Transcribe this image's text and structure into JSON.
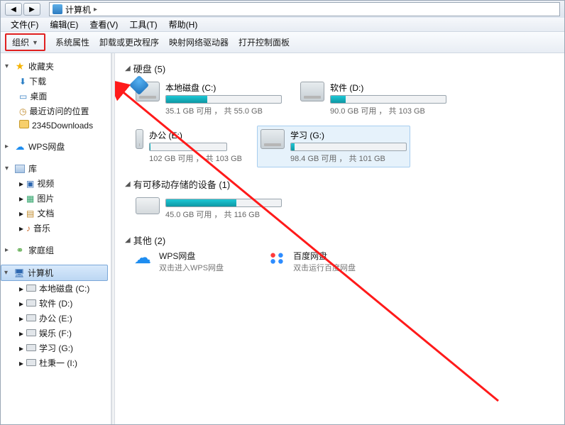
{
  "addressbar": {
    "location": "计算机",
    "chevron": "▸"
  },
  "nav": {
    "back": "◀",
    "forward": "▶"
  },
  "menus": {
    "file": "文件(F)",
    "edit": "编辑(E)",
    "view": "查看(V)",
    "tools": "工具(T)",
    "help": "帮助(H)"
  },
  "toolbar": {
    "organize": "组织",
    "organize_arrow": "▼",
    "system_properties": "系统属性",
    "uninstall": "卸载或更改程序",
    "map_network": "映射网络驱动器",
    "control_panel": "打开控制面板"
  },
  "sidebar": {
    "favorites": {
      "label": "收藏夹",
      "children": {
        "downloads": "下载",
        "desktop": "桌面",
        "recent": "最近访问的位置",
        "dl2345": "2345Downloads"
      }
    },
    "wps": {
      "label": "WPS网盘"
    },
    "libraries": {
      "label": "库",
      "children": {
        "videos": "视频",
        "pictures": "图片",
        "documents": "文档",
        "music": "音乐"
      }
    },
    "homegroup": {
      "label": "家庭组"
    },
    "computer": {
      "label": "计算机",
      "children": {
        "c": "本地磁盘 (C:)",
        "d": "软件 (D:)",
        "e": "办公 (E:)",
        "f": "娱乐 (F:)",
        "g": "学习 (G:)",
        "i": "杜秉一 (I:)"
      }
    }
  },
  "main": {
    "hard_drives": {
      "title": "硬盘 (5)",
      "c": {
        "label": "本地磁盘 (C:)",
        "sub": "35.1 GB 可用 ， 共 55.0 GB",
        "fill": 36
      },
      "d": {
        "label": "软件 (D:)",
        "sub": "90.0 GB 可用 ， 共 103 GB",
        "fill": 13
      },
      "e": {
        "label": "办公 (E:)",
        "sub": "102 GB 可用 ， 共 103 GB",
        "fill": 1
      },
      "g": {
        "label": "学习 (G:)",
        "sub": "98.4 GB 可用 ， 共 101 GB",
        "fill": 3
      }
    },
    "removable": {
      "title": "有可移动存储的设备 (1)",
      "item": {
        "sub": "45.0 GB 可用 ， 共 116 GB",
        "fill": 61
      }
    },
    "other": {
      "title": "其他 (2)",
      "wps": {
        "label": "WPS网盘",
        "sub": "双击进入WPS网盘"
      },
      "baidu": {
        "label": "百度网盘",
        "sub": "双击运行百度网盘"
      }
    }
  }
}
